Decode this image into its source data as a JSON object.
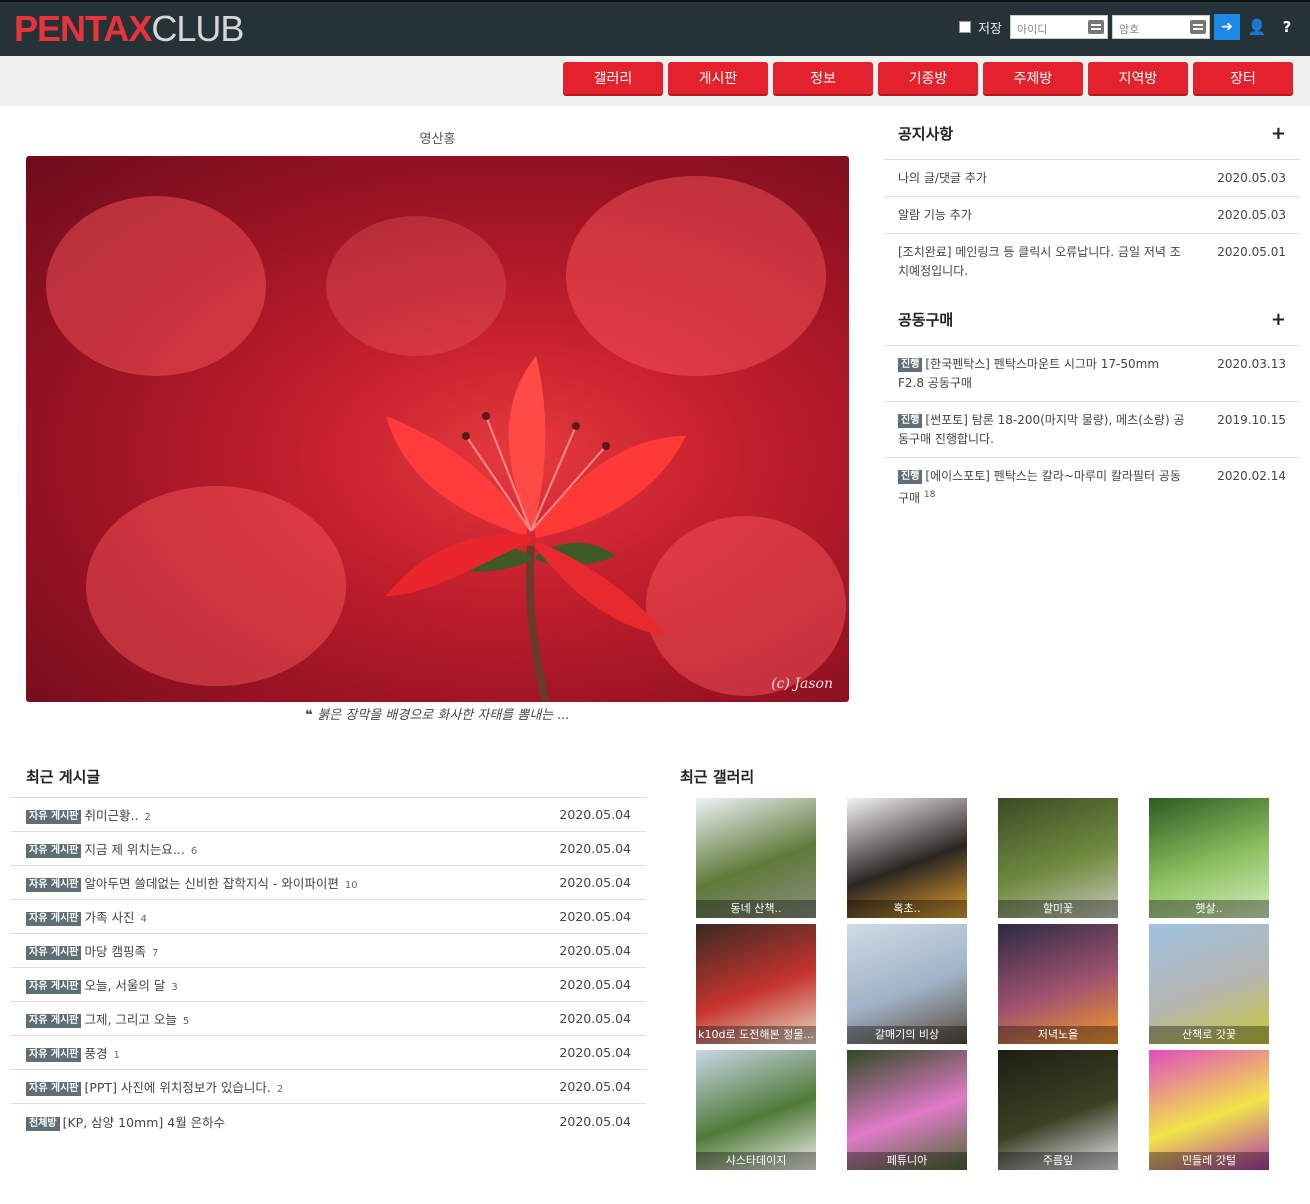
{
  "header": {
    "logo_bold": "PENTAX",
    "logo_thin": "CLUB",
    "save_label": "저장",
    "id_placeholder": "아이디",
    "pw_placeholder": "암호",
    "help_label": "?"
  },
  "nav": [
    "갤러리",
    "게시판",
    "정보",
    "기종방",
    "주제방",
    "지역방",
    "장터"
  ],
  "featured": {
    "title": "영산홍",
    "watermark": "(c) Jason",
    "caption": "붉은 장막을 배경으로 화사한 자태를 뽐내는 ..."
  },
  "notice": {
    "title": "공지사항",
    "plus": "+",
    "items": [
      {
        "text": "나의 글/댓글 추가",
        "date": "2020.05.03"
      },
      {
        "text": "알람 기능 추가",
        "date": "2020.05.03"
      },
      {
        "text": "[조치완료] 메인링크 등 클릭시 오류납니다. 금일 저녁 조치예정입니다.",
        "date": "2020.05.01"
      }
    ]
  },
  "groupbuy": {
    "title": "공동구매",
    "plus": "+",
    "items": [
      {
        "tag": "진행",
        "text": "[한국펜탁스] 펜탁스마운트 시그마 17-50mm F2.8 공동구매",
        "count": "",
        "date": "2020.03.13"
      },
      {
        "tag": "진행",
        "text": "[썬포토] 탐론 18-200(마지막 물량), 메츠(소량) 공동구매 진행합니다.",
        "count": "",
        "date": "2019.10.15"
      },
      {
        "tag": "진행",
        "text": "[에이스포토] 펜탁스는 칼라~마루미 칼라필터 공동구매",
        "count": "18",
        "date": "2020.02.14"
      }
    ]
  },
  "recent_posts": {
    "title": "최근 게시글",
    "items": [
      {
        "tag": "자유 게시판",
        "title": "취미근황..",
        "count": "2",
        "date": "2020.05.04"
      },
      {
        "tag": "자유 게시판",
        "title": "지금 제 위치는요...",
        "count": "6",
        "date": "2020.05.04"
      },
      {
        "tag": "자유 게시판",
        "title": "알아두면 쓸데없는 신비한 잡학지식 - 와이파이편",
        "count": "10",
        "date": "2020.05.04"
      },
      {
        "tag": "자유 게시판",
        "title": "가족 사진",
        "count": "4",
        "date": "2020.05.04"
      },
      {
        "tag": "자유 게시판",
        "title": "마당 캠핑족",
        "count": "7",
        "date": "2020.05.04"
      },
      {
        "tag": "자유 게시판",
        "title": "오늘, 서울의 달",
        "count": "3",
        "date": "2020.05.04"
      },
      {
        "tag": "자유 게시판",
        "title": "그제, 그리고 오늘",
        "count": "5",
        "date": "2020.05.04"
      },
      {
        "tag": "자유 게시판",
        "title": "풍경",
        "count": "1",
        "date": "2020.05.04"
      },
      {
        "tag": "자유 게시판",
        "title": "[PPT] 사진에 위치정보가 있습니다.",
        "count": "2",
        "date": "2020.05.04"
      },
      {
        "tag": "천체방",
        "title": "[KP, 삼양 10mm] 4월 은하수",
        "count": "",
        "date": "2020.05.04"
      }
    ]
  },
  "recent_gallery": {
    "title": "최근 갤러리",
    "items": [
      {
        "caption": "동네 산책..",
        "colors": [
          "#eef2f5",
          "#5f7a3a",
          "#8a8f80"
        ]
      },
      {
        "caption": "혹초..",
        "colors": [
          "#f4f4f4",
          "#2b2522",
          "#e0a030"
        ]
      },
      {
        "caption": "할미꽃",
        "colors": [
          "#3b4b26",
          "#6f8a3e",
          "#c9c9c0"
        ]
      },
      {
        "caption": "햇살..",
        "colors": [
          "#2e5a22",
          "#8cc160",
          "#d6eec0"
        ]
      },
      {
        "caption": "k10d로 도전해본 정물...",
        "colors": [
          "#3a2a22",
          "#c6342e",
          "#e8dcc8"
        ]
      },
      {
        "caption": "갈매기의 비상",
        "colors": [
          "#cfdbe6",
          "#9fb2c6",
          "#5a4a3a"
        ]
      },
      {
        "caption": "저녁노을",
        "colors": [
          "#2b2a44",
          "#a0536e",
          "#f39a2a"
        ]
      },
      {
        "caption": "산책로 갓꽃",
        "colors": [
          "#9fc2e2",
          "#b5b5b0",
          "#c9c93a"
        ]
      },
      {
        "caption": "샤스타데이지",
        "colors": [
          "#c9d7e6",
          "#4f7a3a",
          "#f2f2ea"
        ]
      },
      {
        "caption": "페튜니아",
        "colors": [
          "#2f4a22",
          "#e07ac8",
          "#4a6a30"
        ]
      },
      {
        "caption": "주름잎",
        "colors": [
          "#1d1e14",
          "#3a4224",
          "#e6e8f2"
        ]
      },
      {
        "caption": "민들레 갓털",
        "colors": [
          "#e04cc0",
          "#f2e44a",
          "#b03aa8"
        ]
      }
    ]
  }
}
